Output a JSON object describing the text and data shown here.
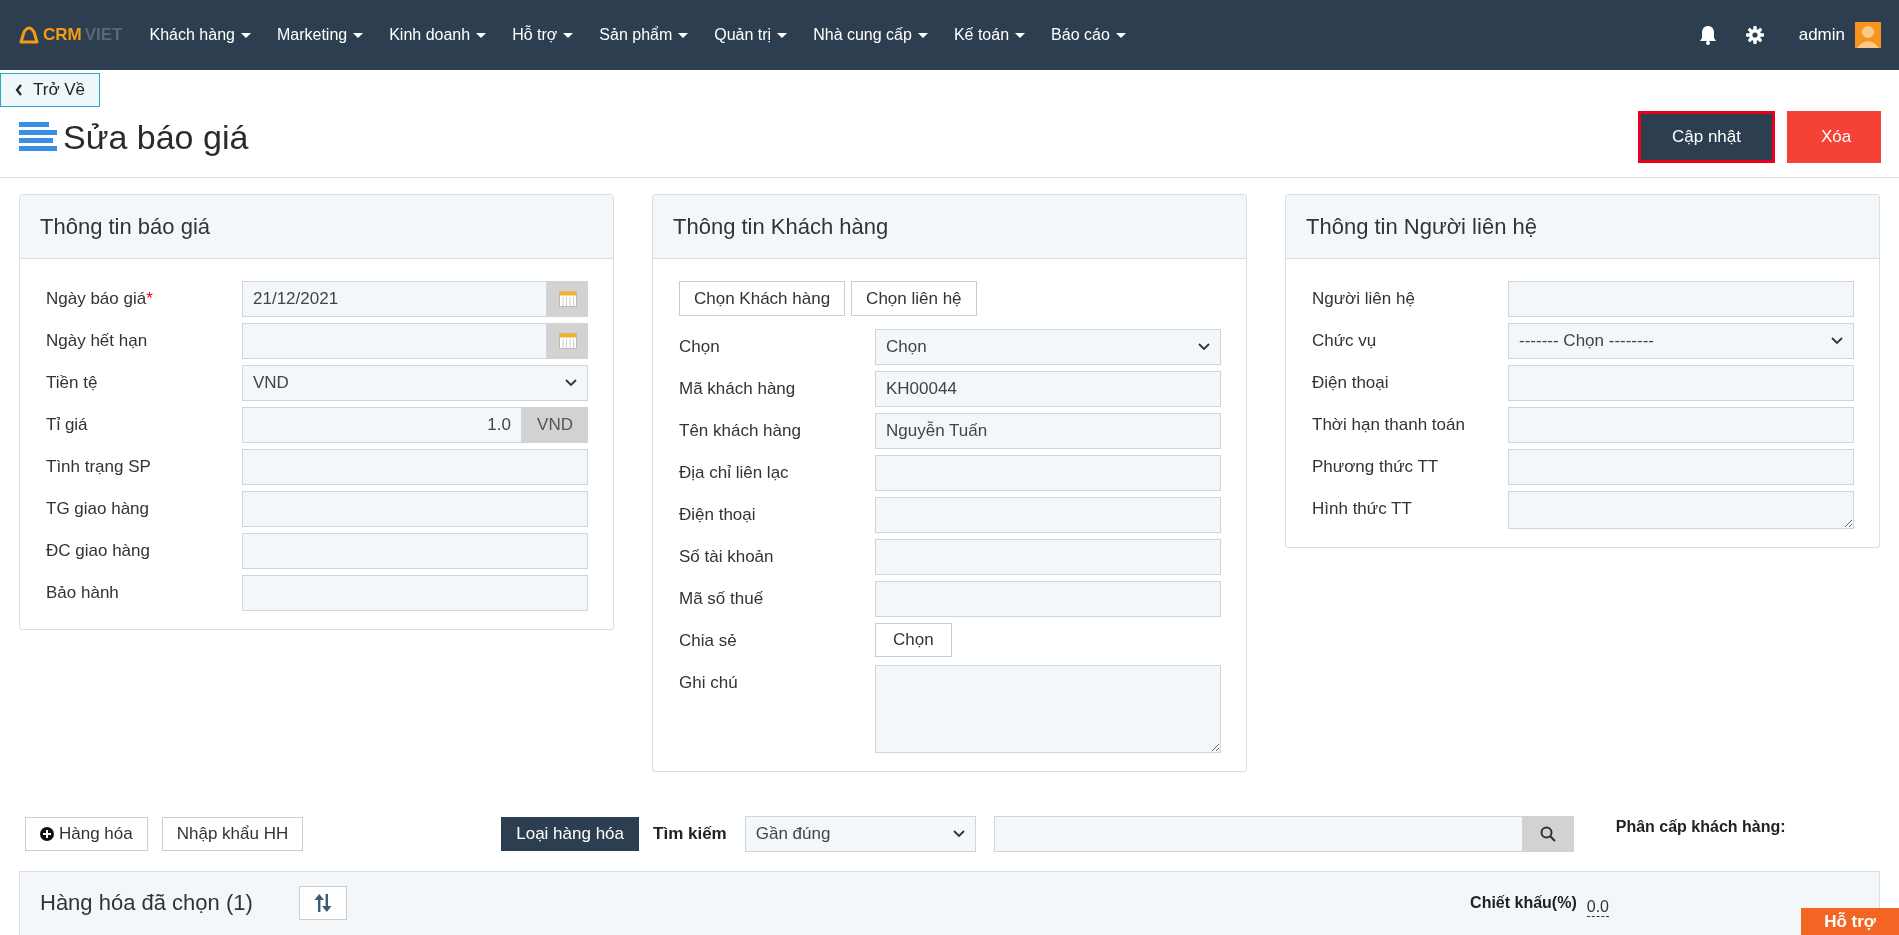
{
  "nav": {
    "logo": {
      "part1": "CRM",
      "part2": "VIET"
    },
    "menu": [
      {
        "label": "Khách hàng"
      },
      {
        "label": "Marketing"
      },
      {
        "label": "Kinh doanh"
      },
      {
        "label": "Hỗ trợ"
      },
      {
        "label": "Sản phẩm"
      },
      {
        "label": "Quản trị"
      },
      {
        "label": "Nhà cung cấp"
      },
      {
        "label": "Kế toán"
      },
      {
        "label": "Báo cáo"
      }
    ],
    "user": "admin"
  },
  "back_button": "Trở Về",
  "page_title": "Sửa báo giá",
  "actions": [
    {
      "label": "Cập nhật",
      "kind": "primary",
      "selected": true
    },
    {
      "label": "Xóa",
      "kind": "danger",
      "selected": false
    }
  ],
  "cards": [
    {
      "title": "Thông tin báo giá",
      "fields": [
        {
          "label": "Ngày báo giá",
          "required_mark": "*",
          "kind": "date",
          "value": "21/12/2021"
        },
        {
          "label": "Ngày hết hạn",
          "kind": "date"
        },
        {
          "label": "Tiền tệ",
          "kind": "select",
          "value": "VND"
        },
        {
          "label": "Tỉ giá",
          "kind": "amount",
          "value": "1.0",
          "addon": "VND"
        },
        {
          "label": "Tình trạng SP",
          "kind": "text"
        },
        {
          "label": "TG giao hàng",
          "kind": "text"
        },
        {
          "label": "ĐC giao hàng",
          "kind": "text"
        },
        {
          "label": "Bảo hành",
          "kind": "text"
        }
      ]
    },
    {
      "title": "Thông tin Khách hàng",
      "buttons": [
        "Chọn Khách hàng",
        "Chọn liên hệ"
      ],
      "fields": [
        {
          "label": "Chọn",
          "kind": "select",
          "value": "Chọn"
        },
        {
          "label": "Mã khách hàng",
          "kind": "text",
          "value": "KH00044"
        },
        {
          "label": "Tên khách hàng",
          "kind": "text",
          "value": "Nguyễn Tuấn"
        },
        {
          "label": "Địa chỉ liên lạc",
          "kind": "text"
        },
        {
          "label": "Điện thoại",
          "kind": "text"
        },
        {
          "label": "Số tài khoản",
          "kind": "text"
        },
        {
          "label": "Mã số thuế",
          "kind": "text"
        },
        {
          "label": "Chia sẻ",
          "kind": "button",
          "value": "Chọn"
        },
        {
          "label": "Ghi chú",
          "kind": "textarea"
        }
      ]
    },
    {
      "title": "Thông tin Người liên hệ",
      "fields": [
        {
          "label": "Người liên hệ",
          "kind": "text"
        },
        {
          "label": "Chức vụ",
          "kind": "select",
          "value": "------- Chọn --------"
        },
        {
          "label": "Điện thoại",
          "kind": "text"
        },
        {
          "label": "Thời hạn thanh toán",
          "kind": "text"
        },
        {
          "label": "Phương thức TT",
          "kind": "text"
        },
        {
          "label": "Hình thức TT",
          "kind": "textarea-small"
        }
      ]
    }
  ],
  "goods_toolbar": {
    "add_button": "Hàng hóa",
    "import_button": "Nhập khẩu HH",
    "category_button": "Loại hàng hóa",
    "search_label": "Tìm kiếm",
    "search_mode": "Gần đúng",
    "tier_label": "Phân cấp khách hàng:"
  },
  "selected_goods": {
    "title": "Hàng hóa đã chọn (1)",
    "discount_label": "Chiết khấu(%)",
    "discount_value": "0.0"
  },
  "help_button": "Hỗ trợ"
}
